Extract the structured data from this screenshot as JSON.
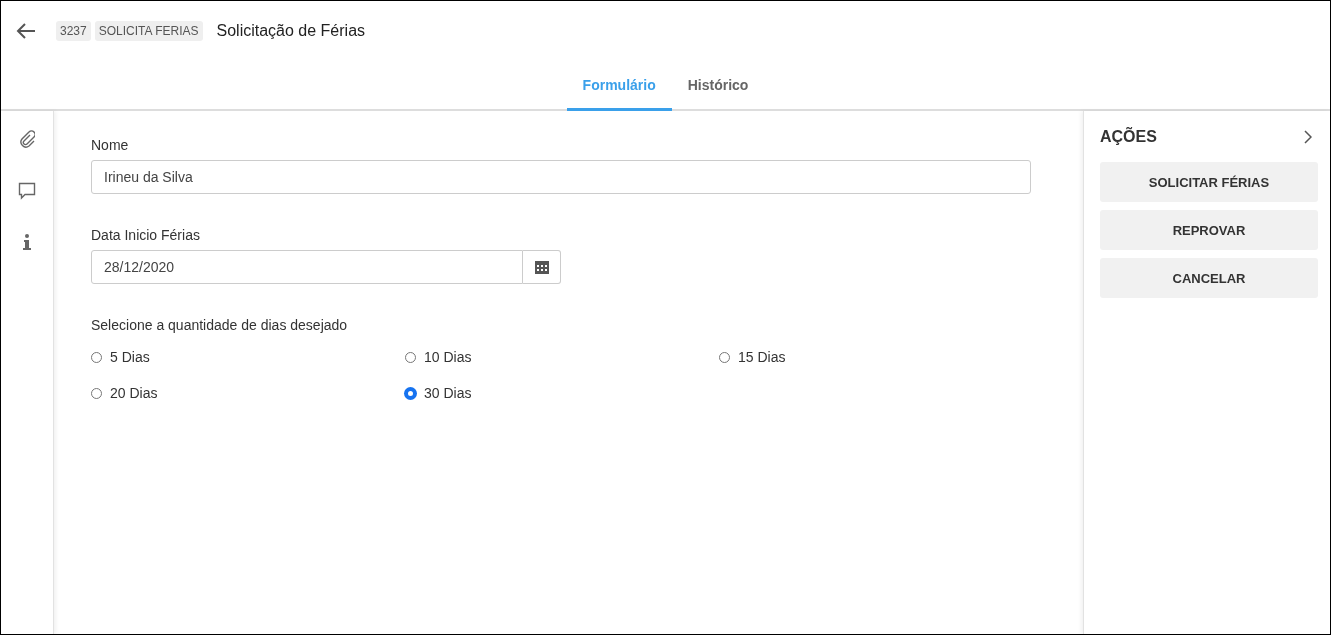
{
  "header": {
    "number_tag": "3237",
    "process_tag": "SOLICITA FERIAS",
    "title": "Solicitação de Férias"
  },
  "tabs": [
    {
      "label": "Formulário",
      "selected": true
    },
    {
      "label": "Histórico",
      "selected": false
    }
  ],
  "form": {
    "name_field": {
      "label": "Nome",
      "value": "Irineu da Silva"
    },
    "date_field": {
      "label": "Data Inicio Férias",
      "value": "28/12/2020"
    },
    "days": {
      "label": "Selecione a quantidade de dias desejado",
      "options": [
        {
          "label": "5 Dias",
          "selected": false
        },
        {
          "label": "10 Dias",
          "selected": false
        },
        {
          "label": "15 Dias",
          "selected": false
        },
        {
          "label": "20 Dias",
          "selected": false
        },
        {
          "label": "30 Dias",
          "selected": true
        }
      ]
    }
  },
  "actions": {
    "title": "AÇÕES",
    "buttons": [
      "SOLICITAR FÉRIAS",
      "REPROVAR",
      "CANCELAR"
    ]
  }
}
